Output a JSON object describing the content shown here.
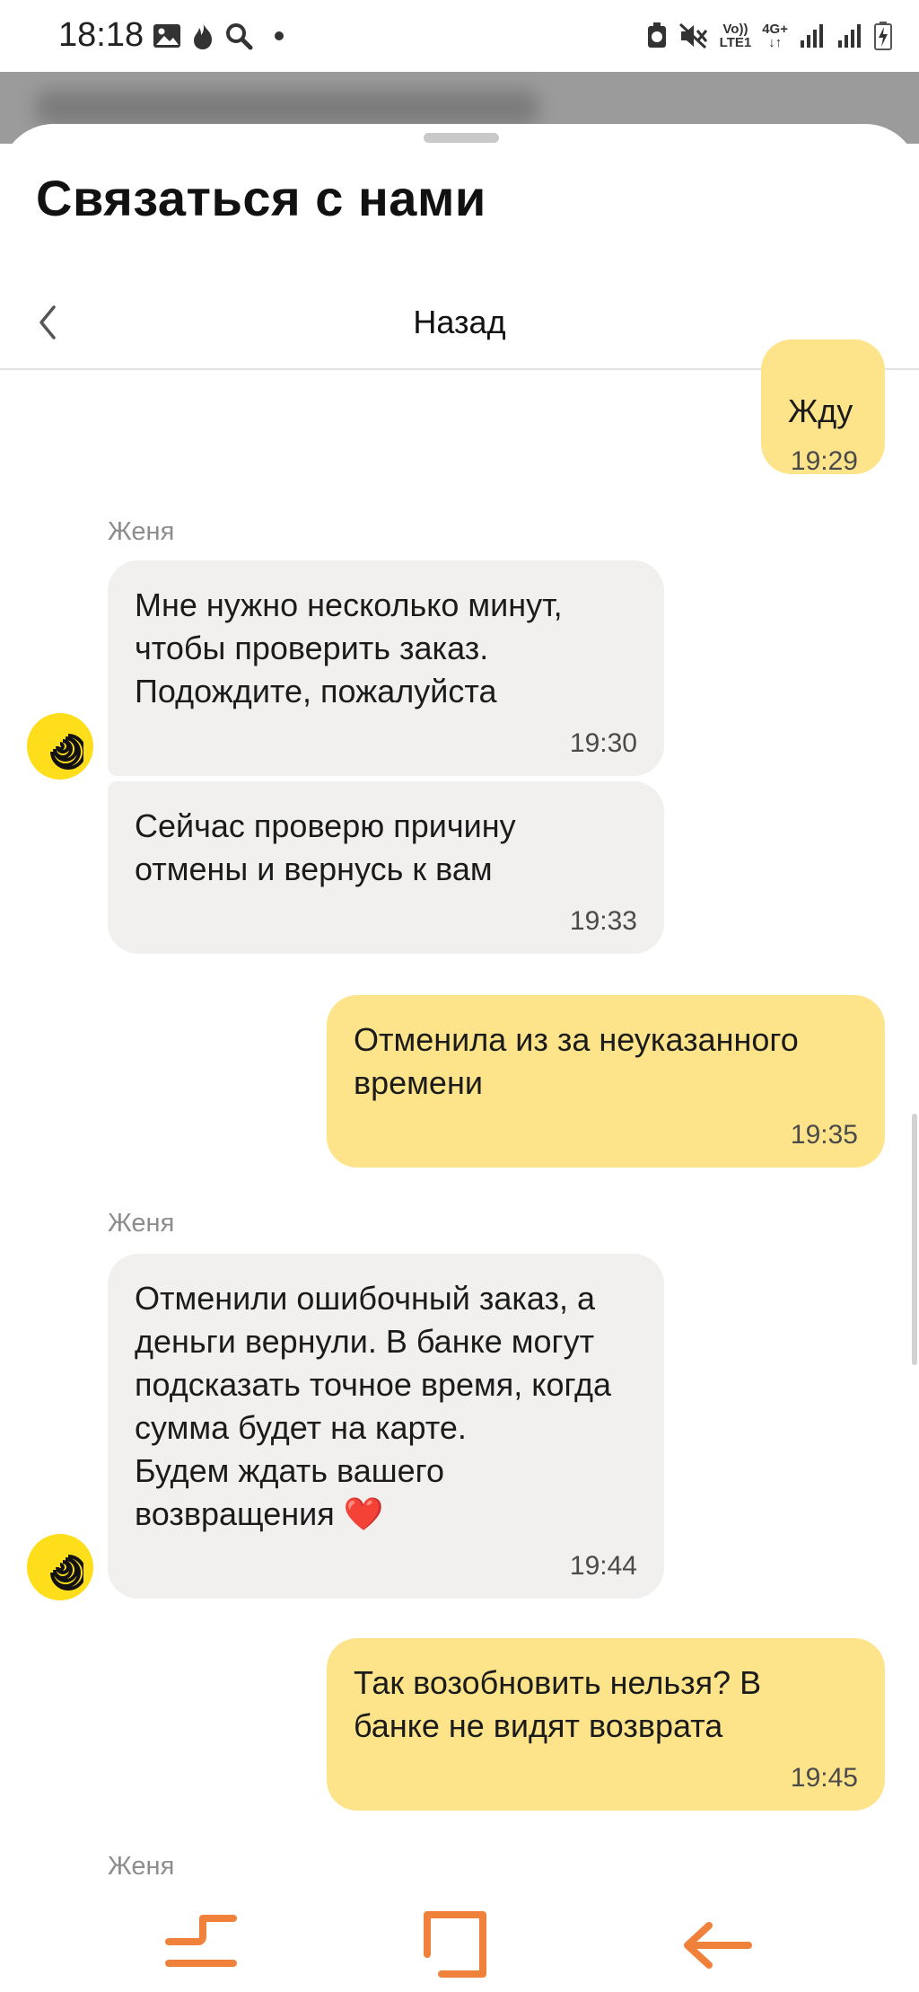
{
  "status_bar": {
    "time": "18:18",
    "left_icons": [
      "gallery-icon",
      "fire-icon",
      "search-icon",
      "dot-icon"
    ],
    "right_icons": [
      "alarm-icon",
      "mute-icon",
      "volte-icon",
      "4g-icon",
      "signal-icon",
      "signal-icon",
      "battery-charging-icon"
    ],
    "volte_label": "Vo))\nLTE1",
    "net_label": "4G+"
  },
  "sheet": {
    "title": "Связаться с нами",
    "back_label": "Назад"
  },
  "colors": {
    "incoming_bubble": "#f1f0ef",
    "outgoing_bubble": "#fde48a",
    "avatar": "#fedd1a",
    "nav_accent": "#f0813a"
  },
  "messages": [
    {
      "direction": "out",
      "text": "Жду",
      "time": "19:29"
    },
    {
      "direction": "in",
      "sender": "Женя",
      "text": "Мне нужно несколько минут,\nчтобы проверить заказ.\nПодождите, пожалуйста",
      "time": "19:30"
    },
    {
      "direction": "in",
      "text": "Сейчас проверю причину\nотмены и вернусь к вам",
      "time": "19:33"
    },
    {
      "direction": "out",
      "text": "Отменила из за неуказанного\nвремени",
      "time": "19:35"
    },
    {
      "direction": "in",
      "sender": "Женя",
      "text": "Отменили ошибочный заказ, а\nденьги вернули. В банке могут\nподсказать точное время, когда\nсумма будет на карте.\nБудем ждать вашего\nвозвращения ❤️",
      "time": "19:44"
    },
    {
      "direction": "out",
      "text": "Так возобновить нельзя? В\nбанке не видят возврата",
      "time": "19:45"
    },
    {
      "direction": "in",
      "sender": "Женя"
    }
  ],
  "bottom_nav": [
    "recents-icon",
    "home-icon",
    "back-arrow-icon"
  ]
}
